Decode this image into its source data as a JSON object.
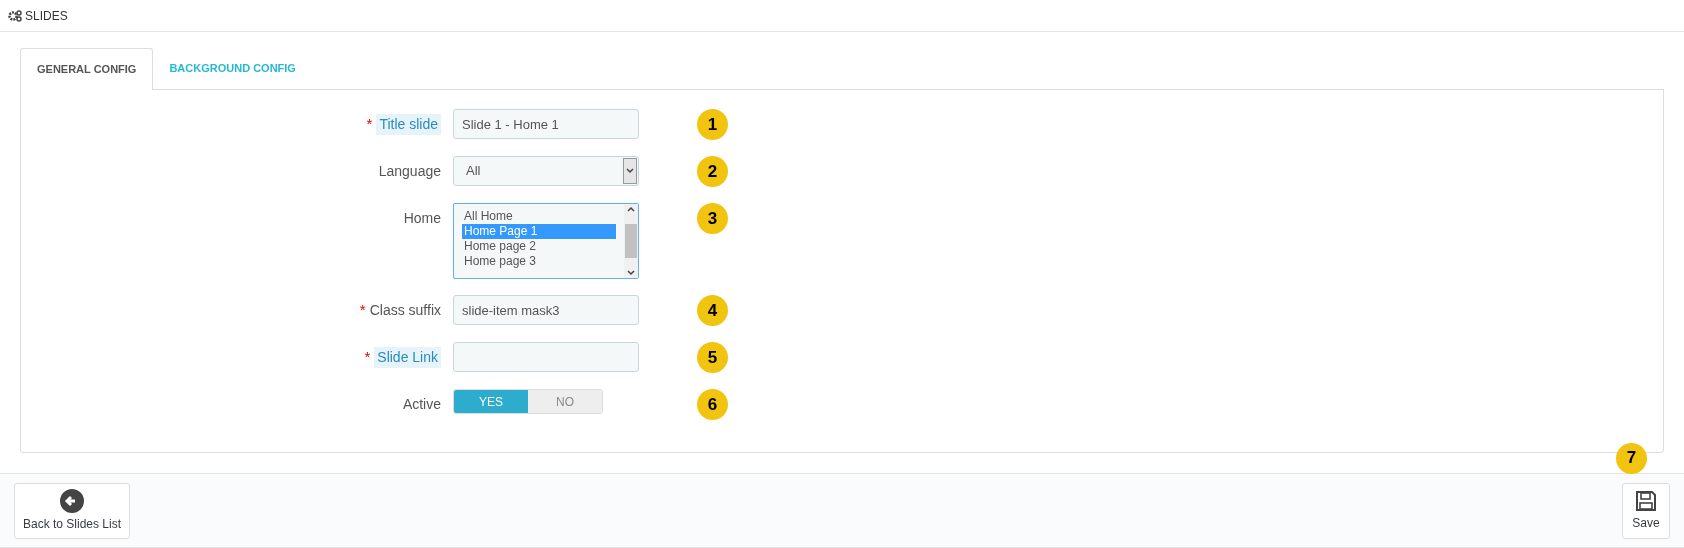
{
  "header": {
    "title": "SLIDES"
  },
  "tabs": [
    {
      "label": "GENERAL CONFIG",
      "selected": true
    },
    {
      "label": "BACKGROUND CONFIG",
      "selected": false
    }
  ],
  "fields": [
    {
      "kind": "text",
      "label": "Title slide",
      "required_mark": "*",
      "hint": true,
      "value": "Slide 1 - Home 1",
      "badge": "1"
    },
    {
      "kind": "select",
      "label": "Language",
      "hint": false,
      "value": "All",
      "badge": "2"
    },
    {
      "kind": "listbox",
      "label": "Home",
      "hint": false,
      "badge": "3",
      "options": [
        {
          "label": "All Home",
          "selected": false
        },
        {
          "label": "Home Page 1",
          "selected": true
        },
        {
          "label": "Home page 2",
          "selected": false
        },
        {
          "label": "Home page 3",
          "selected": false
        }
      ]
    },
    {
      "kind": "text",
      "label": "Class suffix",
      "required_mark": "*",
      "hint": false,
      "value": "slide-item mask3",
      "badge": "4"
    },
    {
      "kind": "text",
      "label": "Slide Link",
      "required_mark": "*",
      "hint": true,
      "badge": "5"
    },
    {
      "kind": "switch",
      "label": "Active",
      "hint": false,
      "on": true,
      "yes": "YES",
      "no": "NO",
      "badge": "6"
    }
  ],
  "footer": {
    "back": "Back to Slides List",
    "save": "Save",
    "save_badge": "7"
  }
}
